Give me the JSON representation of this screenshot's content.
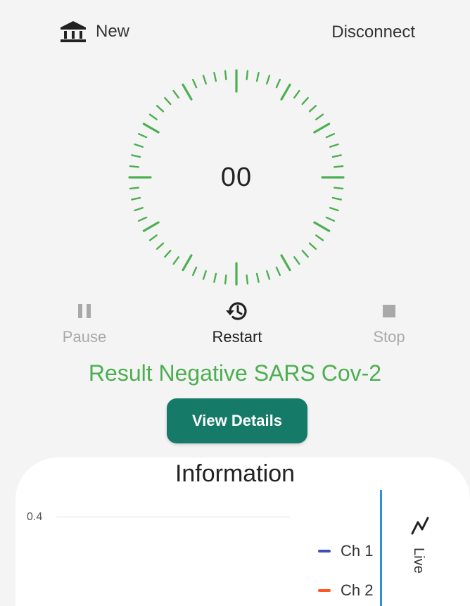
{
  "header": {
    "new_label": "New",
    "disconnect_label": "Disconnect",
    "new_icon": "bank-icon"
  },
  "timer": {
    "count": "00",
    "dial_color": "#4caf50"
  },
  "controls": {
    "pause": {
      "label": "Pause",
      "icon": "pause-icon",
      "enabled": false
    },
    "restart": {
      "label": "Restart",
      "icon": "history-icon",
      "enabled": true
    },
    "stop": {
      "label": "Stop",
      "icon": "stop-icon",
      "enabled": false
    }
  },
  "result": {
    "text": "Result Negative SARS Cov-2",
    "color": "#4caf50"
  },
  "view_details": {
    "label": "View Details",
    "color": "#167a68"
  },
  "information": {
    "title": "Information",
    "y_tick": "0.4",
    "legend": [
      {
        "label": "Ch 1",
        "color": "#3f51b5"
      },
      {
        "label": "Ch 2",
        "color": "#ff5722"
      }
    ],
    "live_label": "Live",
    "live_icon": "trend-icon"
  }
}
